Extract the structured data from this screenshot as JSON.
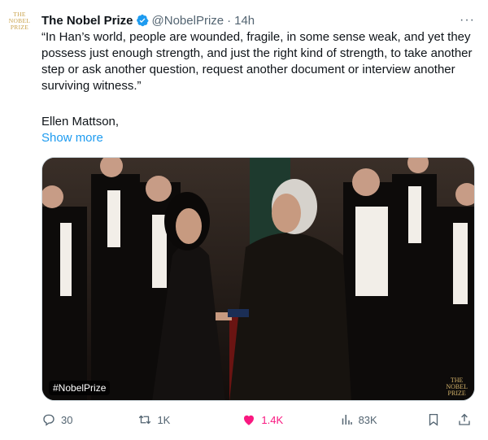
{
  "author": {
    "avatar_lines": [
      "THE",
      "NOBEL",
      "PRIZE"
    ],
    "name": "The Nobel Prize",
    "handle": "@NobelPrize",
    "separator": "·",
    "time": "14h"
  },
  "more_label": "···",
  "tweet": {
    "text": "“In Han’s world, people are wounded, fragile, in some sense weak, and yet they possess just enough strength, and just the right kind of strength, to take another step or ask another question, request another document or interview another surviving witness.”",
    "signature": "Ellen Mattson,",
    "show_more": "Show more"
  },
  "media": {
    "hashtag": "#NobelPrize",
    "watermark_lines": [
      "THE",
      "NOBEL",
      "PRIZE"
    ]
  },
  "actions": {
    "replies": "30",
    "retweets": "1K",
    "likes": "1.4K",
    "views": "83K"
  },
  "colors": {
    "accent": "#1d9bf0",
    "like": "#f91880",
    "muted": "#536471",
    "gold": "#c9a24a"
  }
}
